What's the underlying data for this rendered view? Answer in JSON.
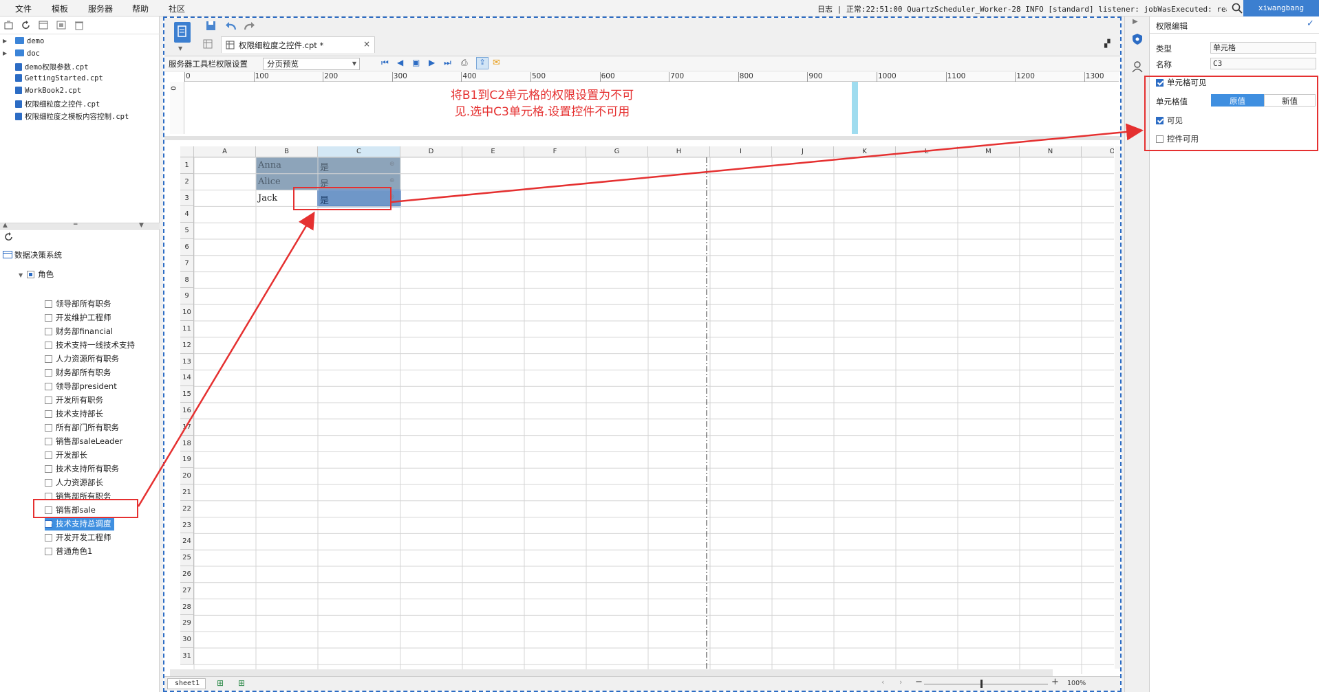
{
  "menu": {
    "file": "文件",
    "template": "模板",
    "server": "服务器",
    "help": "帮助",
    "community": "社区"
  },
  "statusbar": {
    "log": "日志 | 正常:22:51:00 QuartzScheduler_Worker-28 INFO [standard] listener: jobWasExecuted: realtime...",
    "user": "xiwangbang"
  },
  "file_tree": [
    {
      "name": "demo",
      "type": "folder"
    },
    {
      "name": "doc",
      "type": "folder"
    },
    {
      "name": "demo权限参数.cpt",
      "type": "file"
    },
    {
      "name": "GettingStarted.cpt",
      "type": "file"
    },
    {
      "name": "WorkBook2.cpt",
      "type": "file"
    },
    {
      "name": "权限细粒度之控件.cpt",
      "type": "file"
    },
    {
      "name": "权限细粒度之模板内容控制.cpt",
      "type": "file"
    }
  ],
  "auth": {
    "system": "数据决策系统",
    "root_role": "角色",
    "roles": [
      {
        "name": "领导部所有职务",
        "checked": false
      },
      {
        "name": "开发维护工程师",
        "checked": false
      },
      {
        "name": "财务部financial",
        "checked": false
      },
      {
        "name": "技术支持一线技术支持",
        "checked": false
      },
      {
        "name": "人力资源所有职务",
        "checked": false
      },
      {
        "name": "财务部所有职务",
        "checked": false
      },
      {
        "name": "领导部president",
        "checked": false
      },
      {
        "name": "开发所有职务",
        "checked": false
      },
      {
        "name": "技术支持部长",
        "checked": false
      },
      {
        "name": "所有部门所有职务",
        "checked": false
      },
      {
        "name": "销售部saleLeader",
        "checked": false
      },
      {
        "name": "开发部长",
        "checked": false
      },
      {
        "name": "技术支持所有职务",
        "checked": false
      },
      {
        "name": "人力资源部长",
        "checked": false
      },
      {
        "name": "销售部所有职务",
        "checked": false
      },
      {
        "name": "销售部sale",
        "checked": false
      },
      {
        "name": "技术支持总调度",
        "checked": true
      },
      {
        "name": "开发开发工程师",
        "checked": false
      },
      {
        "name": "普通角色1",
        "checked": false
      }
    ]
  },
  "editor": {
    "tab_title": "权限细粒度之控件.cpt *",
    "toolbar_label": "服务器工具栏权限设置",
    "preview_mode": "分页预览",
    "annotation_line1": "将B1到C2单元格的权限设置为不可",
    "annotation_line2": "见.选中C3单元格.设置控件不可用",
    "ruler": [
      "0",
      "100",
      "200",
      "300",
      "400",
      "500",
      "600",
      "700",
      "800",
      "900",
      "1000",
      "1100",
      "1200",
      "1300"
    ],
    "columns": [
      "A",
      "B",
      "C",
      "D",
      "E",
      "F",
      "G",
      "H",
      "I",
      "J",
      "K",
      "L",
      "M",
      "N",
      "O"
    ],
    "cells": [
      {
        "b": "Anna",
        "c": "是"
      },
      {
        "b": "Alice",
        "c": "是"
      },
      {
        "b": "Jack",
        "c": "是"
      }
    ],
    "sheet_name": "sheet1",
    "zoom": "100%"
  },
  "permission_panel": {
    "title": "权限编辑",
    "type_label": "类型",
    "type_value": "单元格",
    "name_label": "名称",
    "name_value": "C3",
    "cell_visible": "单元格可见",
    "cell_value_label": "单元格值",
    "original": "原值",
    "new_value": "新值",
    "visible": "可见",
    "widget_enabled": "控件可用"
  }
}
